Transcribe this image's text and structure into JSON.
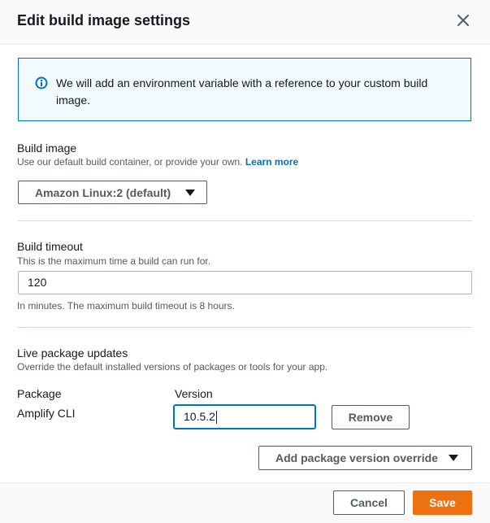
{
  "modal": {
    "title": "Edit build image settings"
  },
  "info": {
    "text": "We will add an environment variable with a reference to your custom build image."
  },
  "build_image": {
    "label": "Build image",
    "description": "Use our default build container, or provide your own.",
    "learn_more": "Learn more",
    "selected": "Amazon Linux:2 (default)"
  },
  "build_timeout": {
    "label": "Build timeout",
    "description": "This is the maximum time a build can run for.",
    "value": "120",
    "hint": "In minutes. The maximum build timeout is 8 hours."
  },
  "live_updates": {
    "label": "Live package updates",
    "description": "Override the default installed versions of packages or tools for your app.",
    "col_package": "Package",
    "col_version": "Version",
    "rows": [
      {
        "package": "Amplify CLI",
        "version": "10.5.2",
        "remove_label": "Remove"
      }
    ],
    "add_override_label": "Add package version override"
  },
  "footer": {
    "cancel_label": "Cancel",
    "save_label": "Save"
  },
  "colors": {
    "primary": "#ec7211",
    "link": "#0073bb",
    "info_bg": "#f1faff"
  },
  "icons": {
    "close": "close-icon",
    "info": "info-icon",
    "caret": "caret-down-icon"
  }
}
